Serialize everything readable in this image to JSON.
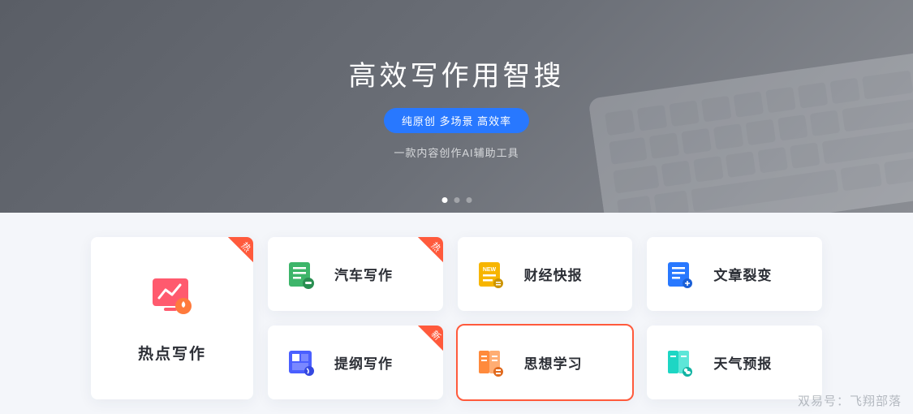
{
  "hero": {
    "title": "高效写作用智搜",
    "badge": "纯原创 多场景 高效率",
    "subtitle": "一款内容创作AI辅助工具"
  },
  "corner_labels": {
    "hot": "热",
    "new": "新"
  },
  "featured": {
    "title": "热点写作"
  },
  "cards": {
    "row1": [
      {
        "title": "汽车写作",
        "icon": "car-doc-icon",
        "color": "#3db56a",
        "corner": "hot"
      },
      {
        "title": "财经快报",
        "icon": "finance-new-icon",
        "color": "#f7b500",
        "corner": ""
      },
      {
        "title": "文章裂变",
        "icon": "split-doc-icon",
        "color": "#2878ff",
        "corner": ""
      }
    ],
    "row2": [
      {
        "title": "提纲写作",
        "icon": "outline-icon",
        "color": "#4a5fff",
        "corner": "new"
      },
      {
        "title": "思想学习",
        "icon": "book-icon",
        "color": "#ff8a3c",
        "corner": ""
      },
      {
        "title": "天气预报",
        "icon": "weather-icon",
        "color": "#1dd6c4",
        "corner": ""
      }
    ]
  },
  "watermark": "双易号：飞翔部落"
}
